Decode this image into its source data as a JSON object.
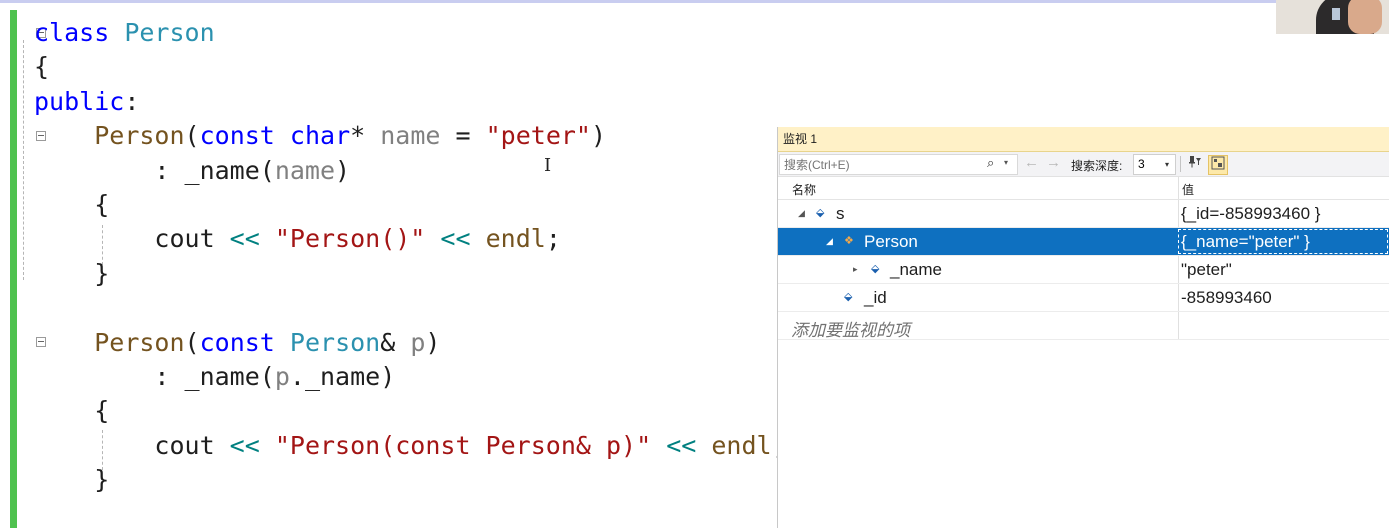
{
  "editor": {
    "lines": [
      [
        {
          "t": "class",
          "c": "kw"
        },
        {
          "t": " "
        },
        {
          "t": "Person",
          "c": "ty"
        }
      ],
      [
        {
          "t": "{"
        }
      ],
      [
        {
          "t": "public",
          "c": "kw"
        },
        {
          "t": ":"
        }
      ],
      [
        {
          "t": "    "
        },
        {
          "t": "Person",
          "c": "fn"
        },
        {
          "t": "("
        },
        {
          "t": "const",
          "c": "kw"
        },
        {
          "t": " "
        },
        {
          "t": "char",
          "c": "kw"
        },
        {
          "t": "* "
        },
        {
          "t": "name",
          "c": "pm"
        },
        {
          "t": " = "
        },
        {
          "t": "\"peter\"",
          "c": "st"
        },
        {
          "t": ")"
        }
      ],
      [
        {
          "t": "        : _name("
        },
        {
          "t": "name",
          "c": "pm"
        },
        {
          "t": ")"
        }
      ],
      [
        {
          "t": "    {"
        }
      ],
      [
        {
          "t": "        cout "
        },
        {
          "t": "<<",
          "c": "op"
        },
        {
          "t": " "
        },
        {
          "t": "\"Person()\"",
          "c": "st"
        },
        {
          "t": " "
        },
        {
          "t": "<<",
          "c": "op"
        },
        {
          "t": " "
        },
        {
          "t": "endl",
          "c": "fn"
        },
        {
          "t": ";"
        }
      ],
      [
        {
          "t": "    }"
        }
      ],
      [
        {
          "t": ""
        }
      ],
      [
        {
          "t": "    "
        },
        {
          "t": "Person",
          "c": "fn"
        },
        {
          "t": "("
        },
        {
          "t": "const",
          "c": "kw"
        },
        {
          "t": " "
        },
        {
          "t": "Person",
          "c": "ty"
        },
        {
          "t": "& "
        },
        {
          "t": "p",
          "c": "pm"
        },
        {
          "t": ")"
        }
      ],
      [
        {
          "t": "        : _name("
        },
        {
          "t": "p",
          "c": "pm"
        },
        {
          "t": "._name)"
        }
      ],
      [
        {
          "t": "    {"
        }
      ],
      [
        {
          "t": "        cout "
        },
        {
          "t": "<<",
          "c": "op"
        },
        {
          "t": " "
        },
        {
          "t": "\"Person(const Person& p)\"",
          "c": "st"
        },
        {
          "t": " "
        },
        {
          "t": "<<",
          "c": "op"
        },
        {
          "t": " "
        },
        {
          "t": "endl",
          "c": "fn"
        },
        {
          "t": ";"
        }
      ],
      [
        {
          "t": "    }"
        }
      ]
    ],
    "cursor_glyph": "I"
  },
  "watch": {
    "title": "监视 1",
    "search_placeholder": "搜索(Ctrl+E)",
    "search_icon": "⌕",
    "dropdown_glyph": "▾",
    "back_glyph": "←",
    "forward_glyph": "→",
    "depth_label": "搜索深度:",
    "depth_value": "3",
    "col_name": "名称",
    "col_value": "值",
    "rows": [
      {
        "name": "s",
        "value": "{_id=-858993460 }",
        "expand": "◢",
        "icon": "⬙",
        "selected": false
      },
      {
        "name": "Person",
        "value": "{_name=\"peter\" }",
        "expand": "◢",
        "icon": "❖",
        "selected": true
      },
      {
        "name": "_name",
        "value": "\"peter\"",
        "expand": "▸",
        "icon": "⬙",
        "selected": false
      },
      {
        "name": "_id",
        "value": "-858993460",
        "expand": "",
        "icon": "⬙",
        "selected": false
      }
    ],
    "add_item": "添加要监视的项"
  },
  "colors": {
    "keyword": "#0000ff",
    "type": "#2b91af",
    "function": "#74531f",
    "param": "#808080",
    "string": "#a31515",
    "operator": "#008080",
    "selection": "#0e70c0",
    "title_bar": "#fff1c7",
    "change_bar": "#4fc24f"
  }
}
